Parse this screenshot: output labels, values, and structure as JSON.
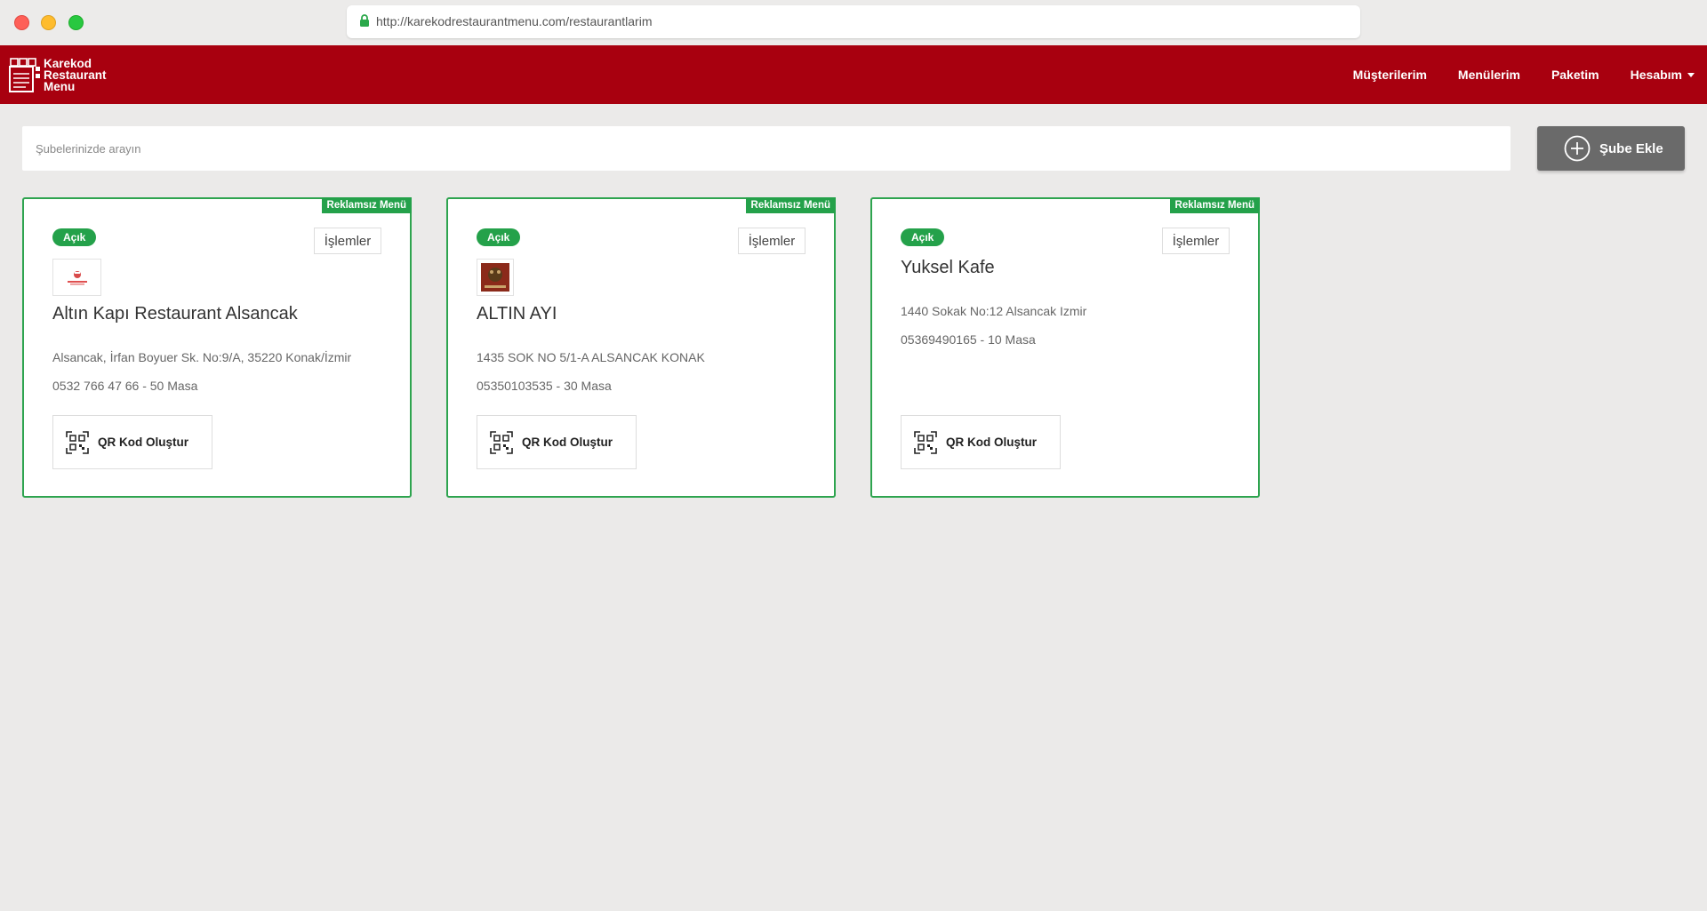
{
  "browser": {
    "url": "http://karekodrestaurantmenu.com/restaurantlarim"
  },
  "brand": {
    "line1": "Karekod",
    "line2": "Restaurant",
    "line3": "Menu"
  },
  "nav": {
    "items": [
      {
        "label": "Müşterilerim"
      },
      {
        "label": "Menülerim"
      },
      {
        "label": "Paketim"
      },
      {
        "label": "Hesabım"
      }
    ]
  },
  "search": {
    "placeholder": "Şubelerinizde arayın",
    "value": ""
  },
  "add_branch": {
    "label": "Şube Ekle"
  },
  "colors": {
    "navbar": "#a8000f",
    "accent_green": "#24a14a",
    "add_button": "#6a6a6a"
  },
  "cards": [
    {
      "ribbon": "Reklamsız Menü",
      "status": "Açık",
      "actions_label": "İşlemler",
      "name": "Altın Kapı Restaurant Alsancak",
      "address": "Alsancak, İrfan Boyuer Sk. No:9/A, 35220 Konak/İzmir",
      "phone_tables": "0532 766 47 66 - 50 Masa",
      "qr_label": "QR Kod Oluştur"
    },
    {
      "ribbon": "Reklamsız Menü",
      "status": "Açık",
      "actions_label": "İşlemler",
      "name": "ALTIN AYI",
      "address": "1435 SOK NO 5/1-A ALSANCAK KONAK",
      "phone_tables": "05350103535 - 30 Masa",
      "qr_label": "QR Kod Oluştur"
    },
    {
      "ribbon": "Reklamsız Menü",
      "status": "Açık",
      "actions_label": "İşlemler",
      "name": "Yuksel Kafe",
      "address": "1440 Sokak No:12 Alsancak Izmir",
      "phone_tables": "05369490165 - 10 Masa",
      "qr_label": "QR Kod Oluştur"
    }
  ]
}
